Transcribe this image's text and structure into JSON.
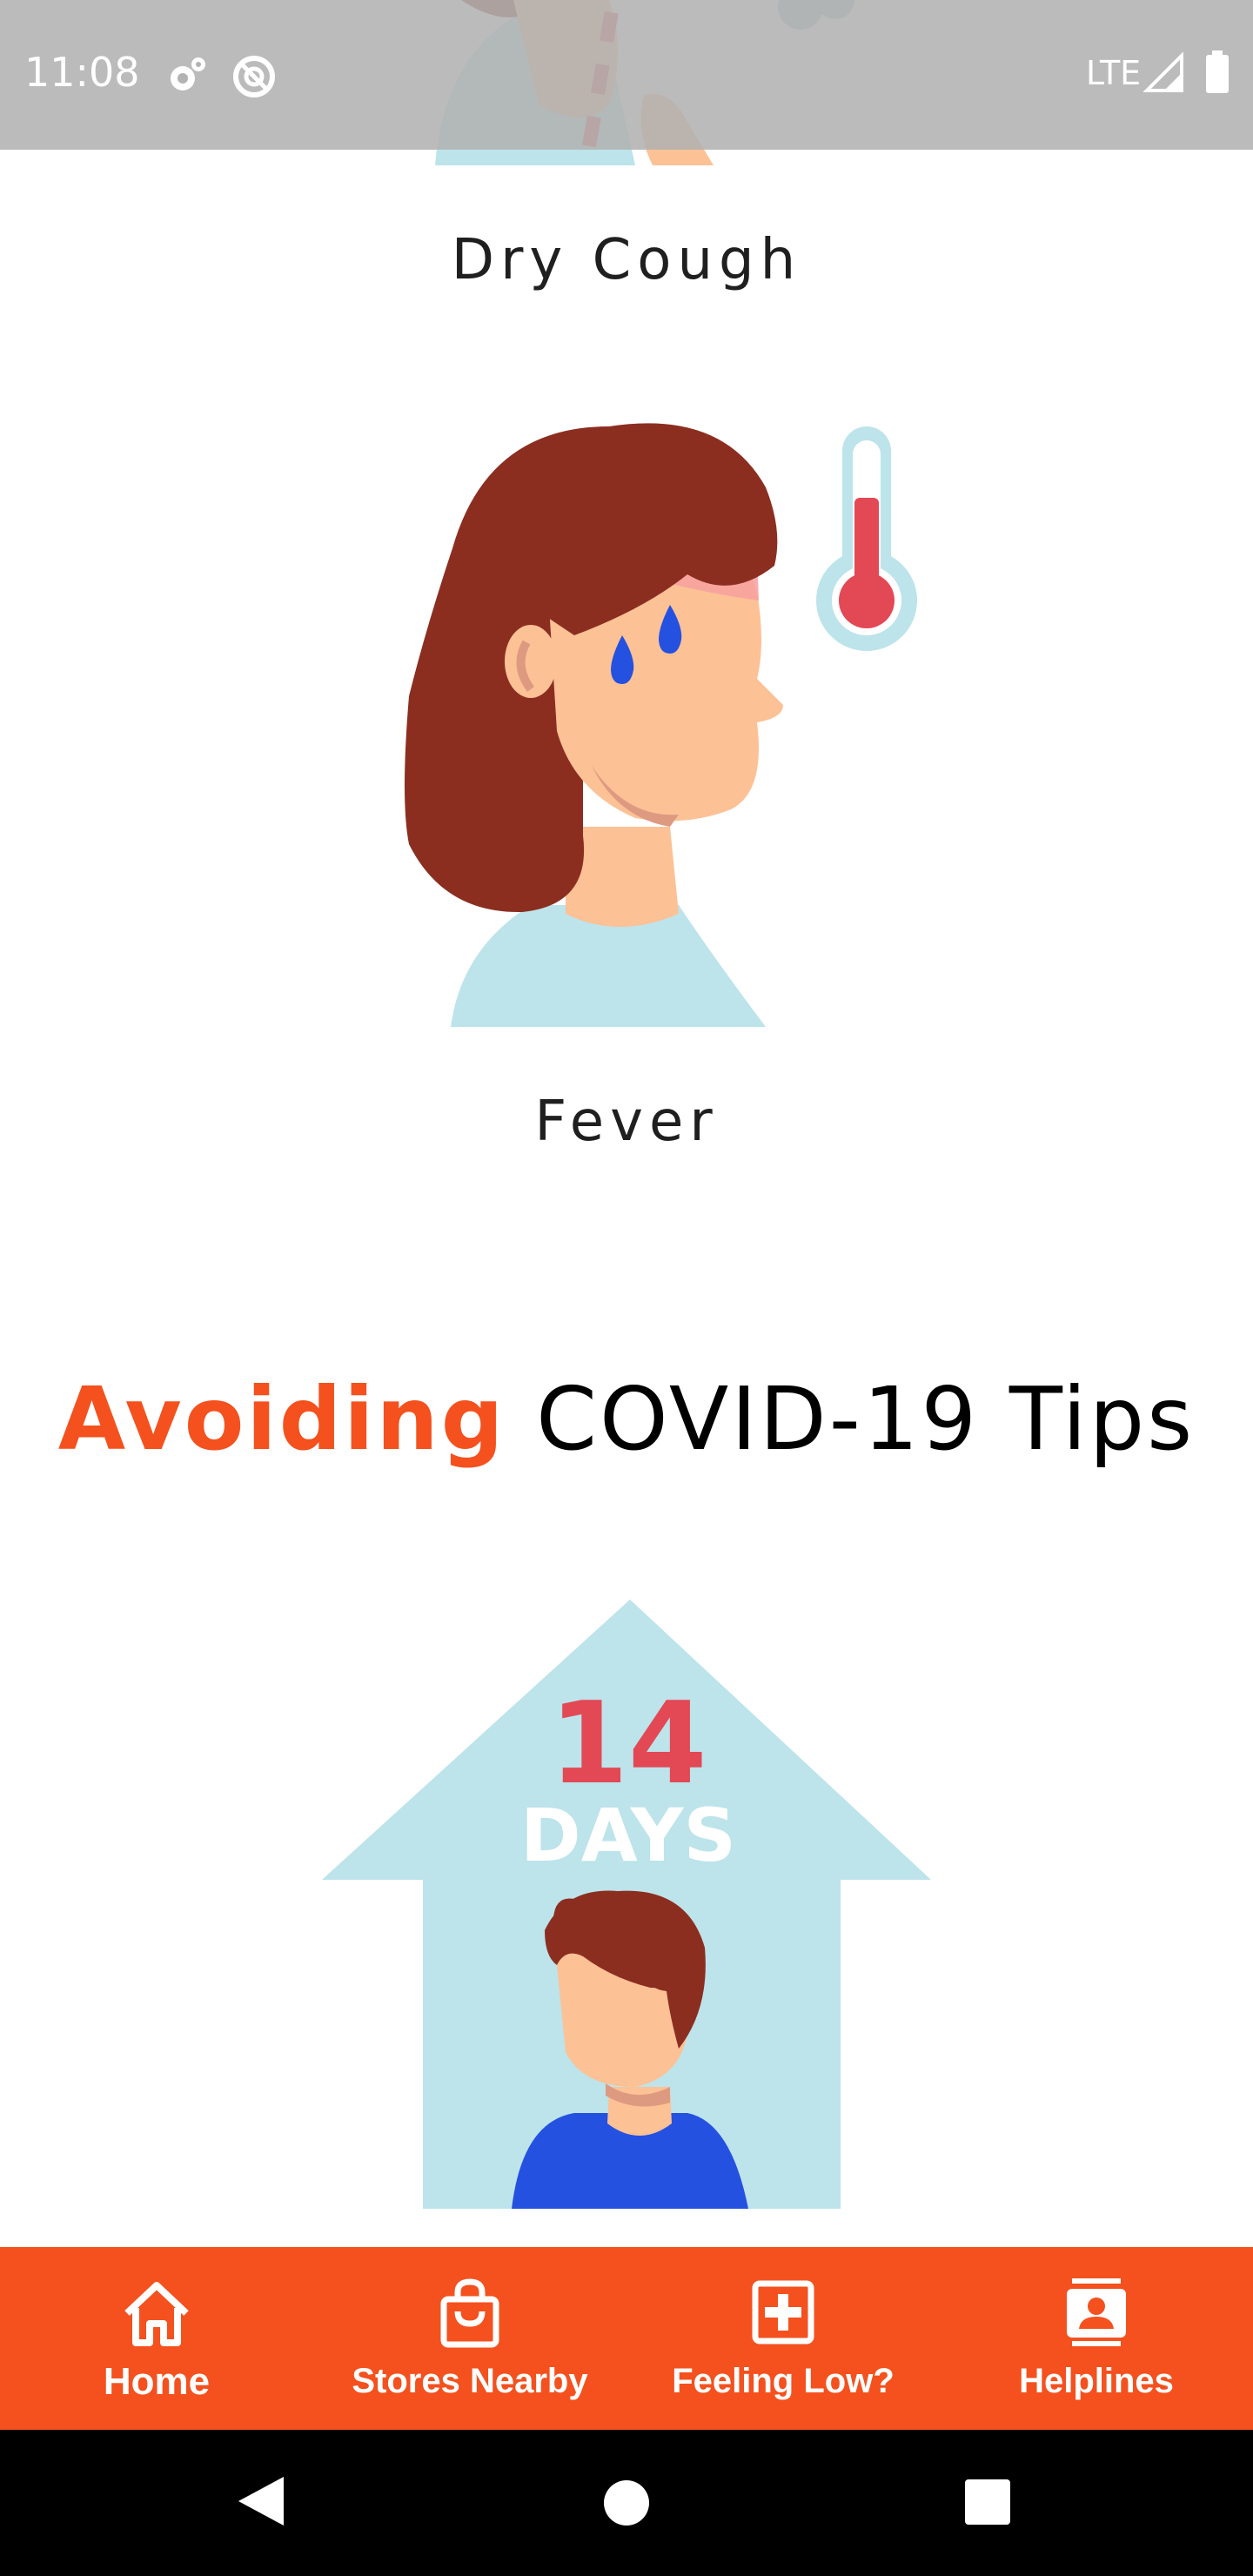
{
  "status_bar": {
    "time": "11:08",
    "network": "LTE",
    "icons": [
      "gear-icon",
      "do-not-disturb-icon",
      "cell-signal-icon",
      "battery-icon"
    ]
  },
  "symptoms": {
    "dry_cough": {
      "caption": "Dry Cough"
    },
    "fever": {
      "caption": "Fever"
    }
  },
  "tips": {
    "heading_accent": "Avoiding",
    "heading_rest": " COVID-19 Tips",
    "quarantine_number": "14",
    "quarantine_unit": "DAYS"
  },
  "bottom_nav": {
    "items": [
      {
        "label": "Home",
        "icon": "home-icon",
        "active": true
      },
      {
        "label": "Stores Nearby",
        "icon": "shopping-bag-icon",
        "active": false
      },
      {
        "label": "Feeling Low?",
        "icon": "medical-cross-icon",
        "active": false
      },
      {
        "label": "Helplines",
        "icon": "contacts-icon",
        "active": false
      }
    ]
  },
  "colors": {
    "accent": "#f4511e",
    "illustration_light_blue": "#bce4ea",
    "hair": "#8b2e20",
    "skin": "#fdc196",
    "thermometer_red": "#e34855",
    "shirt_blue": "#2451e0"
  }
}
